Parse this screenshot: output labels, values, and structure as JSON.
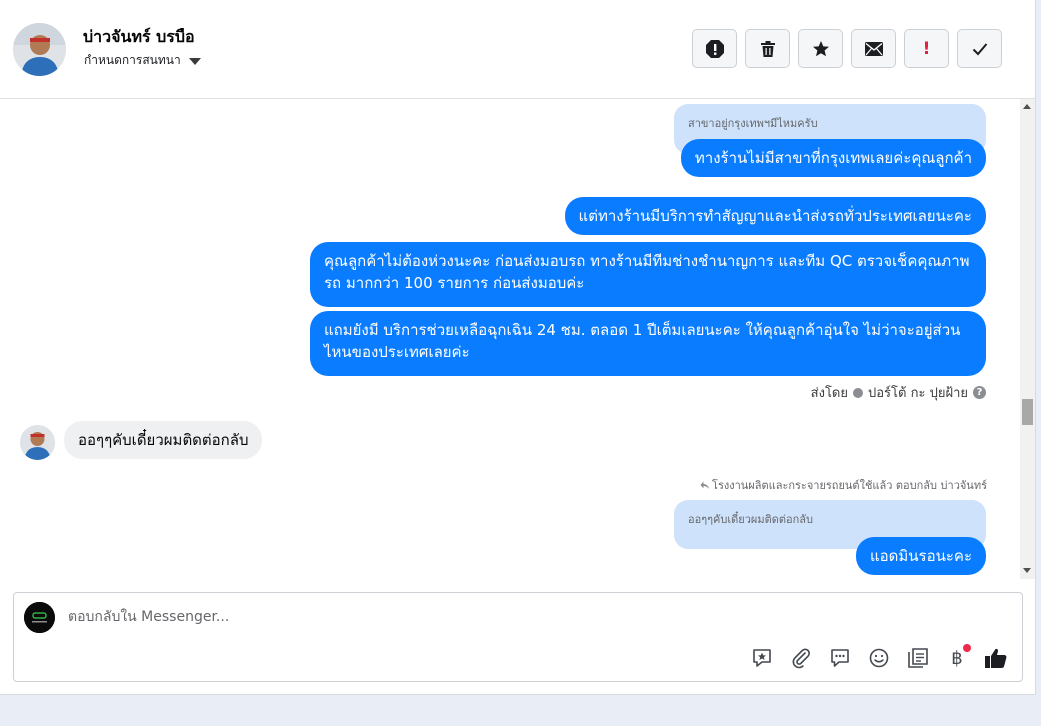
{
  "header": {
    "contact_name": "บ่าวจันทร์ บรบือ",
    "assign_label": "กำหนดการสนทนา",
    "actions": [
      {
        "icon": "alert-circle-icon",
        "name": "spam-button"
      },
      {
        "icon": "trash-icon",
        "name": "delete-button"
      },
      {
        "icon": "star-icon",
        "name": "star-button"
      },
      {
        "icon": "mail-icon",
        "name": "mark-unread-button"
      },
      {
        "icon": "exclamation-icon",
        "name": "follow-up-button",
        "label": "!"
      },
      {
        "icon": "checkmark-icon",
        "name": "mark-done-button"
      }
    ]
  },
  "conversation": {
    "quoted_1": "สาขาอยู่กรุงเทพฯมีไหมครับ",
    "outgoing": [
      "ทางร้านไม่มีสาขาที่กรุงเทพเลยค่ะคุณลูกค้า",
      "แต่ทางร้านมีบริการทำสัญญาและนำส่งรถทั่วประเทศเลยนะคะ",
      "คุณลูกค้าไม่ต้องห่วงนะคะ ก่อนส่งมอบรถ ทางร้านมีทีมช่างชำนาญการ และทีม QC ตรวจเช็คคุณภาพรถ มากกว่า 100 รายการ ก่อนส่งมอบค่ะ",
      "แถมยังมี บริการช่วยเหลือฉุกเฉิน 24 ชม. ตลอด 1 ปีเต็มเลยนะคะ ให้คุณลูกค้าอุ่นใจ ไม่ว่าจะอยู่ส่วนไหนของประเทศเลยค่ะ"
    ],
    "sent_by_label": "ส่งโดย",
    "sent_by_name": "ปอร์โต้ กะ ปุยฝ้าย",
    "help_label": "?",
    "incoming": "ออๆๆคับเดี๋ยวผมติดต่อกลับ",
    "reply_note": "โรงงานผลิตและกระจายรถยนต์ใช้แล้ว ตอบกลับ บ่าวจันทร์",
    "quoted_2": "ออๆๆคับเดี๋ยวผมติดต่อกลับ",
    "last_outgoing": "แอดมินรอนะคะ"
  },
  "composer": {
    "placeholder": "ตอบกลับใน Messenger...",
    "tools": [
      "saved-reply-icon",
      "attachment-icon",
      "chat-bubble-icon",
      "emoji-icon",
      "catalog-icon",
      "payment-icon",
      "thumbs-up-icon"
    ],
    "payment_symbol": "฿"
  },
  "colors": {
    "accent": "#0a7cff",
    "quote_bg": "#cfe2fb",
    "incoming_bg": "#eff0f2",
    "notification": "#f02849",
    "alert_red": "#e41e3f"
  }
}
